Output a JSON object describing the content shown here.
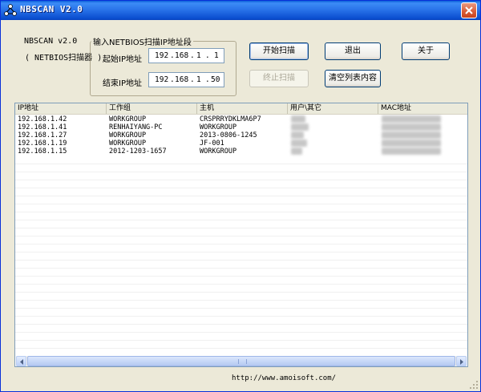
{
  "window": {
    "title": "NBSCAN V2.0",
    "close_icon": "close-icon"
  },
  "info": {
    "version": "NBSCAN v2.0",
    "subtitle": "( NETBIOS扫描器 )"
  },
  "range": {
    "group_title": "输入NETBIOS扫描IP地址段",
    "start_label": "起始IP地址",
    "end_label": "结束IP地址",
    "start_ip": [
      "192",
      "168",
      "1",
      "1"
    ],
    "end_ip": [
      "192",
      "168",
      "1",
      "50"
    ],
    "dot": "."
  },
  "buttons": {
    "start": "开始扫描",
    "stop": "终止扫描",
    "exit": "退出",
    "clear": "清空列表内容",
    "about": "关于"
  },
  "table": {
    "columns": [
      "IP地址",
      "工作组",
      "主机",
      "用户\\其它",
      "MAC地址"
    ],
    "rows": [
      {
        "ip": "192.168.1.42",
        "group": "WORKGROUP",
        "host": "CRSPRRYDKLMA6P7"
      },
      {
        "ip": "192.168.1.41",
        "group": "RENHAIYANG-PC",
        "host": "WORKGROUP"
      },
      {
        "ip": "192.168.1.27",
        "group": "WORKGROUP",
        "host": "2013-0806-1245"
      },
      {
        "ip": "192.168.1.19",
        "group": "WORKGROUP",
        "host": "JF-001"
      },
      {
        "ip": "192.168.1.15",
        "group": "2012-1203-1657",
        "host": "WORKGROUP"
      }
    ]
  },
  "footer": {
    "url": "http://www.amoisoft.com/"
  },
  "colors": {
    "titlebar": "#0a5fd8",
    "window_bg": "#ece9d8",
    "close": "#d95b35"
  }
}
